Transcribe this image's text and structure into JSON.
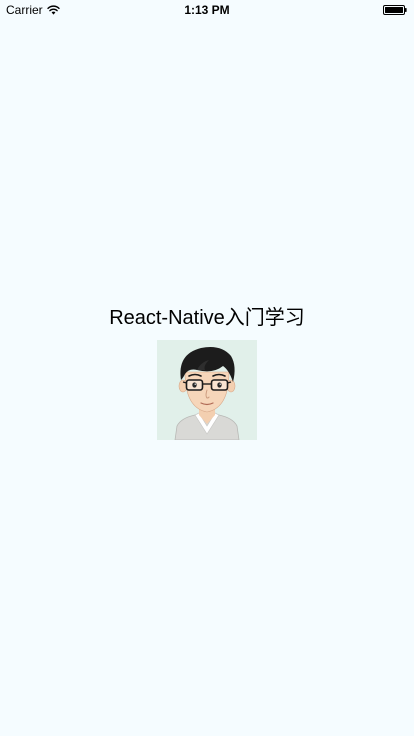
{
  "status_bar": {
    "carrier": "Carrier",
    "time": "1:13 PM",
    "icons": [
      "wifi-icon",
      "battery-icon"
    ]
  },
  "main": {
    "title": "React-Native入门学习",
    "avatar_image": "cartoon-man-with-glasses-avatar"
  },
  "colors": {
    "background": "#f5fcff",
    "avatar_background": "#e1f0ea"
  }
}
